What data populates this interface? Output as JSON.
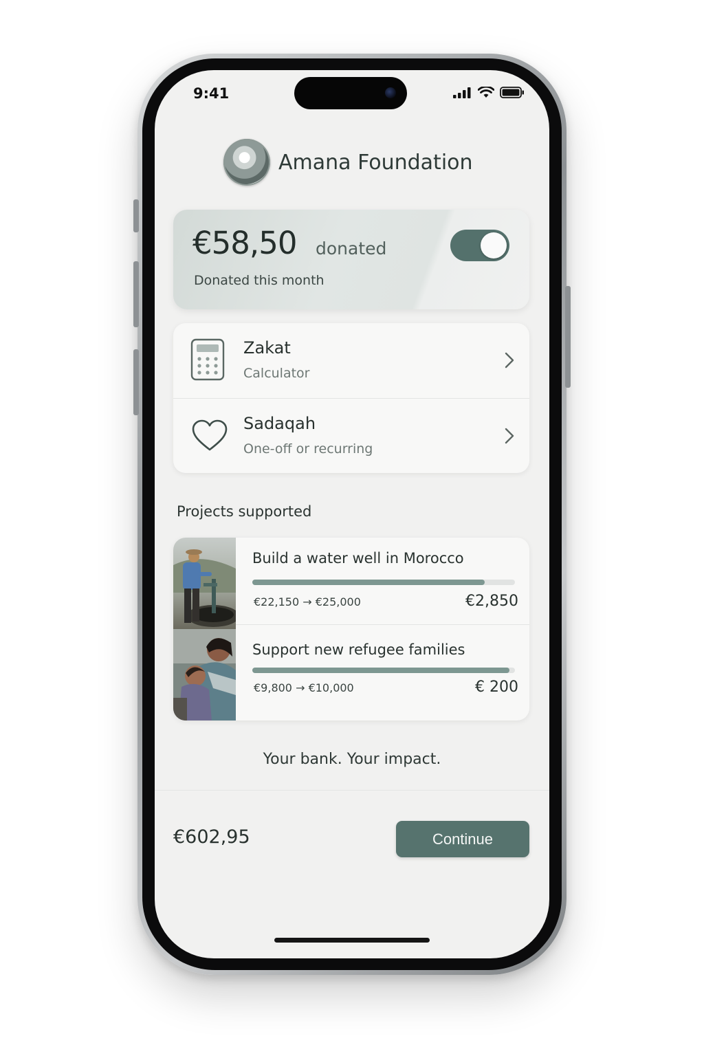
{
  "status_bar": {
    "time": "9:41"
  },
  "header": {
    "org_name": "Amana Foundation",
    "logo_icon": "foundation-logo-icon"
  },
  "donation_summary": {
    "amount": "€58,50",
    "amount_suffix": "donated",
    "subtitle": "Donated this month",
    "toggle_on": true,
    "accent_color": "#54716c"
  },
  "menu": {
    "items": [
      {
        "title": "Zakat",
        "subtitle": "Calculator",
        "icon": "calculator-icon"
      },
      {
        "title": "Sadaqah",
        "subtitle": "One-off or recurring",
        "icon": "heart-icon"
      }
    ]
  },
  "projects": {
    "section_title": "Projects supported",
    "items": [
      {
        "title": "Build a water well in Morocco",
        "range": "€22,150 → €25,000",
        "amount": "€2,850",
        "progress": 0.886
      },
      {
        "title": "Support new refugee families",
        "range": "€9,800 → €10,000",
        "amount": "€ 200",
        "progress": 0.98
      }
    ]
  },
  "tagline": "Your bank. Your impact.",
  "footer": {
    "total": "€602,95",
    "continue_label": "Continue"
  }
}
